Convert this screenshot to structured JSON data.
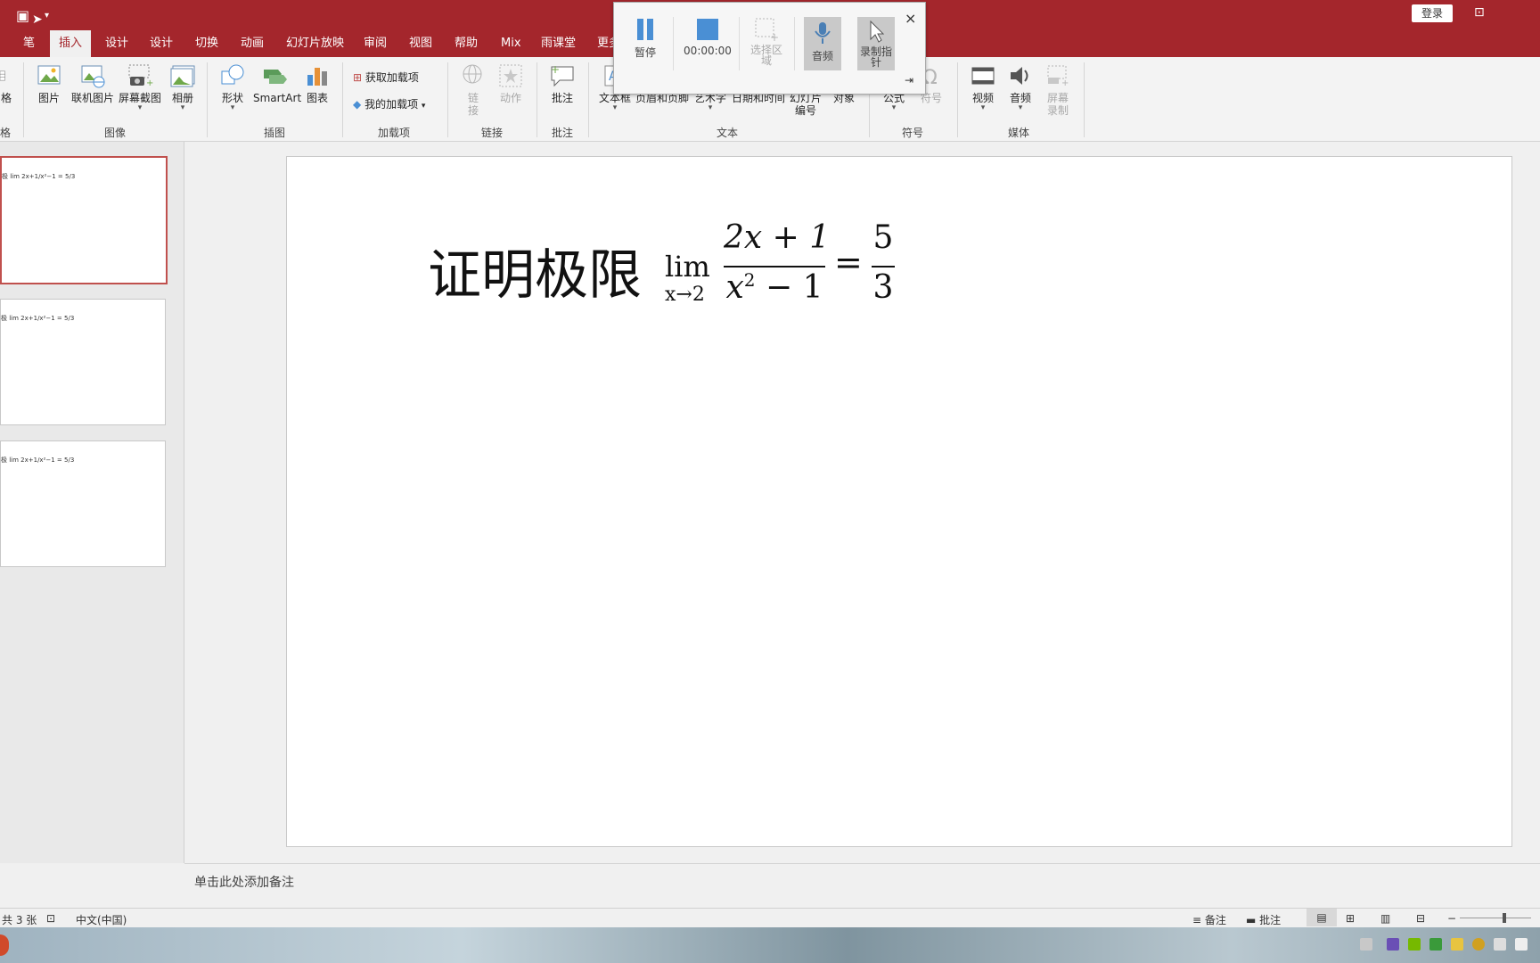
{
  "titlebar": {
    "login": "登录",
    "tabs": [
      "笔",
      "插入",
      "设计",
      "设计",
      "切换",
      "动画",
      "幻灯片放映",
      "审阅",
      "视图",
      "帮助",
      "Mix",
      "雨课堂",
      "更多"
    ],
    "active_tab": "插入"
  },
  "ribbon": {
    "left_cut_label": "格",
    "left_cut_group": "格",
    "groups": {
      "image": "图像",
      "illustration": "插图",
      "addins": "加载项",
      "links": "链接",
      "comments": "批注",
      "text": "文本",
      "symbols": "符号",
      "media": "媒体"
    },
    "buttons": {
      "picture": "图片",
      "online_picture": "联机图片",
      "screenshot": "屏幕截图",
      "album": "相册",
      "shapes": "形状",
      "smartart": "SmartArt",
      "chart": "图表",
      "get_addins": "获取加载项",
      "my_addins": "我的加载项",
      "link_l1": "链",
      "link_l2": "接",
      "action": "动作",
      "comment": "批注",
      "textbox": "文本框",
      "header_footer": "页眉和页脚",
      "wordart": "艺术字",
      "datetime": "日期和时间",
      "slide_num_l1": "幻灯片",
      "slide_num_l2": "编号",
      "object": "对象",
      "equation": "公式",
      "symbol": "符号",
      "video": "视频",
      "audio": "音频",
      "screen_rec_l1": "屏幕",
      "screen_rec_l2": "录制"
    }
  },
  "recorder": {
    "pause": "暂停",
    "time": "00:00:00",
    "select_area_l1": "选择区",
    "select_area_l2": "域",
    "audio": "音频",
    "record_pointer_l1": "录制指",
    "record_pointer_l2": "针",
    "close": "×"
  },
  "thumbnails": [
    {
      "label": "极 lim 2x+1/x²−1 = 5/3"
    },
    {
      "label": "极 lim 2x+1/x²−1 = 5/3"
    },
    {
      "label": "极 lim 2x+1/x²−1 = 5/3"
    }
  ],
  "slide": {
    "title": "证明极限",
    "lim": "lim",
    "lim_sub": "x→2",
    "num": "2x + 1",
    "den_base": "x",
    "den_exp": "2",
    "den_rest": " − 1",
    "eq": "=",
    "rhs_num": "5",
    "rhs_den": "3"
  },
  "notes": {
    "placeholder": "单击此处添加备注"
  },
  "status": {
    "slide_count": "共 3 张",
    "language": "中文(中国)",
    "notes_btn": "备注",
    "comments_btn": "批注"
  }
}
